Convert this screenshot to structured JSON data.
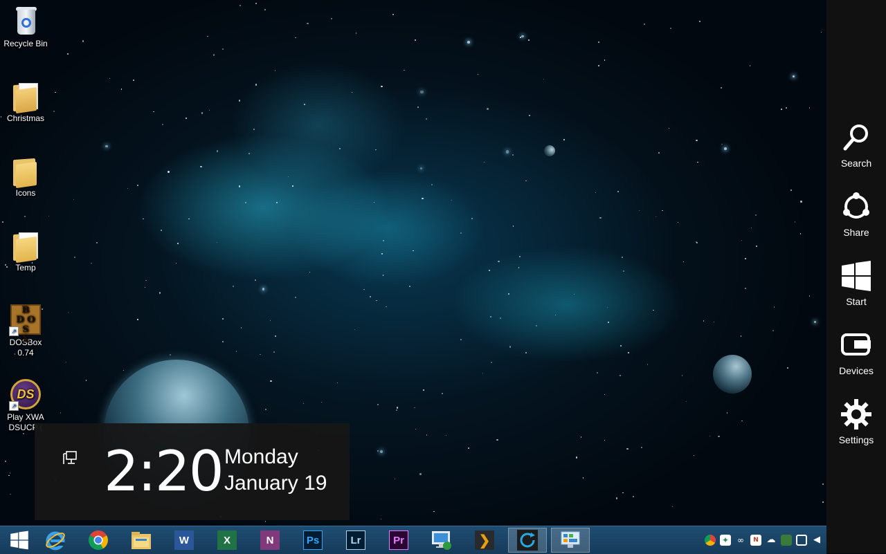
{
  "desktop": {
    "icons": [
      {
        "label": "Recycle Bin",
        "icon": "recycle-bin-icon"
      },
      {
        "label": "Christmas",
        "icon": "folder-icon"
      },
      {
        "label": "Icons",
        "icon": "folder-icon"
      },
      {
        "label": "Temp",
        "icon": "folder-icon"
      },
      {
        "label": "DOSBox 0.74",
        "icon": "dosbox-icon"
      },
      {
        "label_line1": "Play XWA",
        "label_line2": "DSUCP (",
        "icon": "xwa-icon"
      }
    ],
    "dosbox_letters": [
      "B",
      "D",
      "O",
      "S",
      "X"
    ],
    "xwa_letters": "DS"
  },
  "charms": {
    "items": [
      {
        "label": "Search",
        "icon": "search-icon"
      },
      {
        "label": "Share",
        "icon": "share-icon"
      },
      {
        "label": "Start",
        "icon": "windows-logo-icon"
      },
      {
        "label": "Devices",
        "icon": "devices-icon"
      },
      {
        "label": "Settings",
        "icon": "gear-icon"
      }
    ]
  },
  "clock": {
    "time": "2:20",
    "day": "Monday",
    "date": "January 19"
  },
  "taskbar": {
    "apps": [
      {
        "name": "start",
        "icon": "windows-logo-icon"
      },
      {
        "name": "internet-explorer",
        "icon": "ie-icon"
      },
      {
        "name": "chrome",
        "icon": "chrome-icon"
      },
      {
        "name": "file-explorer",
        "icon": "folder-icon"
      },
      {
        "name": "word",
        "icon": "word-icon",
        "glyph": "W"
      },
      {
        "name": "excel",
        "icon": "excel-icon",
        "glyph": "X"
      },
      {
        "name": "onenote",
        "icon": "onenote-icon",
        "glyph": "N"
      },
      {
        "name": "photoshop",
        "icon": "photoshop-icon",
        "glyph": "Ps"
      },
      {
        "name": "lightroom",
        "icon": "lightroom-icon",
        "glyph": "Lr"
      },
      {
        "name": "premiere",
        "icon": "premiere-icon",
        "glyph": "Pr"
      },
      {
        "name": "remote-desktop",
        "icon": "remote-desktop-icon"
      },
      {
        "name": "plex",
        "icon": "plex-icon",
        "glyph": "❯"
      },
      {
        "name": "sync-app",
        "icon": "sync-icon"
      },
      {
        "name": "control-panel",
        "icon": "control-panel-icon"
      }
    ],
    "colors": {
      "word": "#2b579a",
      "excel": "#217346",
      "onenote": "#80397b",
      "photoshop": "#001d34",
      "photoshop_text": "#31a8ff",
      "lightroom": "#001d34",
      "lightroom_text": "#add5ec",
      "premiere": "#2a0634",
      "premiere_text": "#e77bff"
    },
    "tray_icons": [
      "chrome-tray-icon",
      "dropbox-icon",
      "link-icon",
      "nvidia-icon",
      "onedrive-icon",
      "usb-icon",
      "network-icon",
      "volume-icon"
    ]
  }
}
